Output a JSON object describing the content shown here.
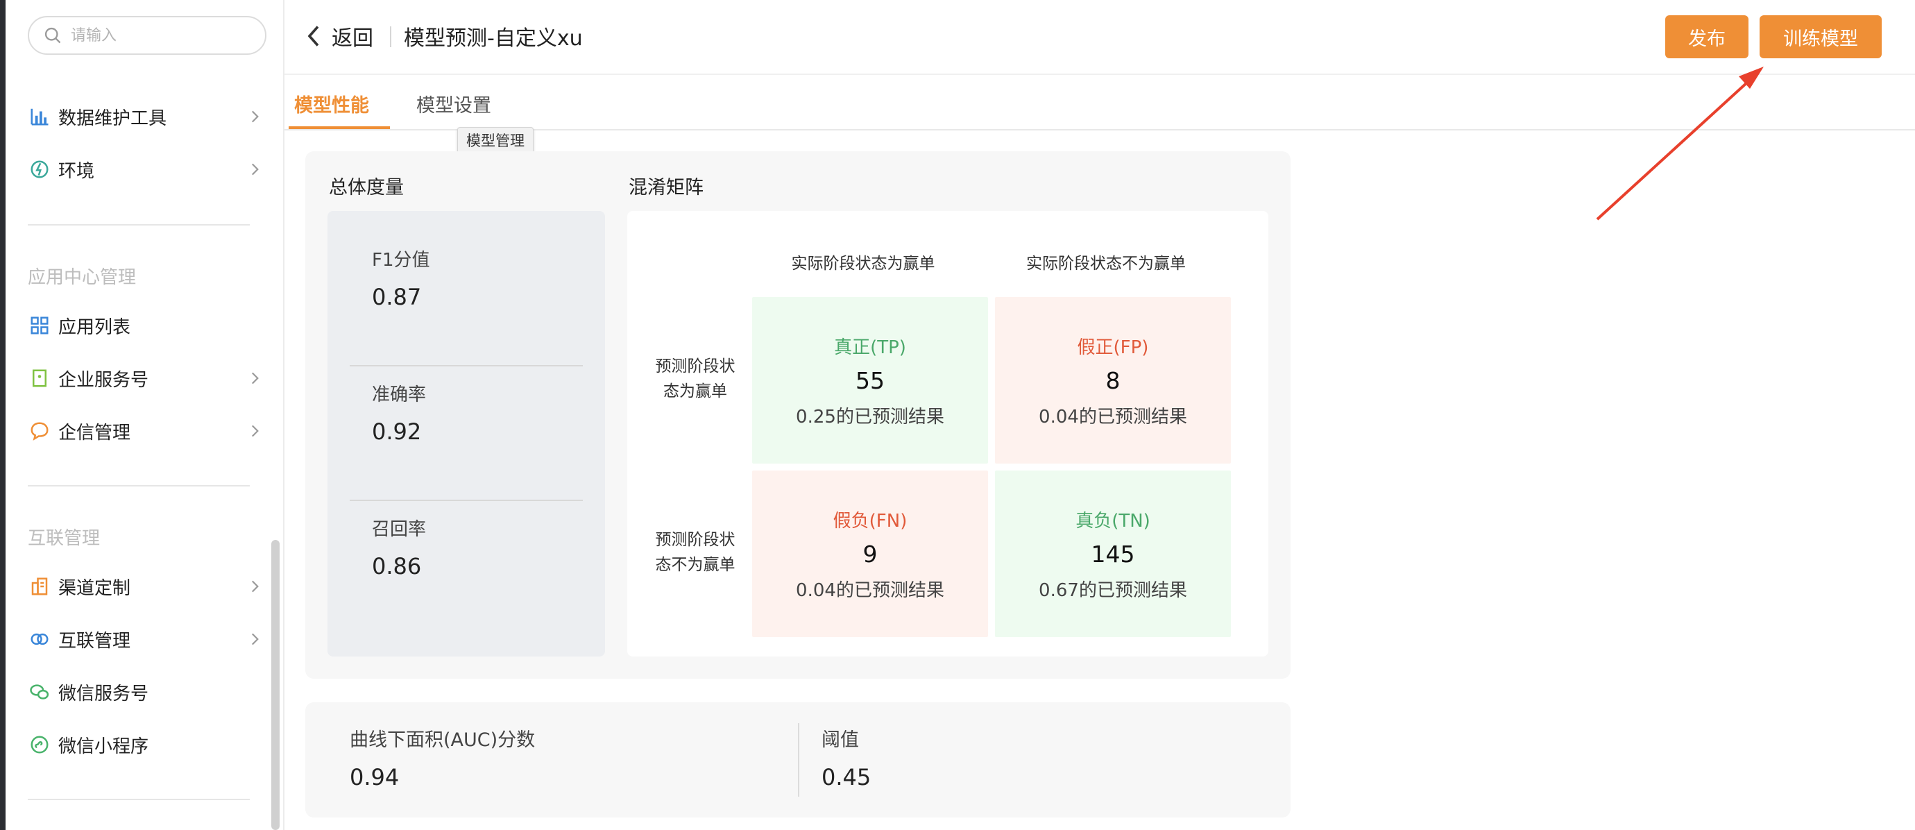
{
  "sidebar": {
    "search_placeholder": "请输入",
    "items": [
      {
        "label": "数据维护工具"
      },
      {
        "label": "环境"
      },
      {
        "label": "应用列表"
      },
      {
        "label": "企业服务号"
      },
      {
        "label": "企信管理"
      },
      {
        "label": "渠道定制"
      },
      {
        "label": "互联管理"
      },
      {
        "label": "微信服务号"
      },
      {
        "label": "微信小程序"
      }
    ],
    "sections": [
      {
        "title": "应用中心管理"
      },
      {
        "title": "互联管理"
      }
    ]
  },
  "header": {
    "back_label": "返回",
    "title": "模型预测-自定义xu",
    "publish_label": "发布",
    "train_label": "训练模型"
  },
  "tabs": {
    "performance": "模型性能",
    "settings": "模型设置",
    "tooltip": "模型管理"
  },
  "overall": {
    "title": "总体度量",
    "metrics": [
      {
        "label": "F1分值",
        "value": "0.87"
      },
      {
        "label": "准确率",
        "value": "0.92"
      },
      {
        "label": "召回率",
        "value": "0.86"
      }
    ]
  },
  "matrix": {
    "title": "混淆矩阵",
    "col_headers": [
      "实际阶段状态为赢单",
      "实际阶段状态不为赢单"
    ],
    "row_headers": [
      {
        "line1": "预测阶段状",
        "line2": "态为赢单"
      },
      {
        "line1": "预测阶段状",
        "line2": "态不为赢单"
      }
    ],
    "cells": [
      {
        "name": "真正(TP)",
        "value": "55",
        "desc": "0.25的已预测结果"
      },
      {
        "name": "假正(FP)",
        "value": "8",
        "desc": "0.04的已预测结果"
      },
      {
        "name": "假负(FN)",
        "value": "9",
        "desc": "0.04的已预测结果"
      },
      {
        "name": "真负(TN)",
        "value": "145",
        "desc": "0.67的已预测结果"
      }
    ]
  },
  "auc": {
    "label": "曲线下面积(AUC)分数",
    "value": "0.94",
    "threshold_label": "阈值",
    "threshold_value": "0.45"
  },
  "colors": {
    "accent": "#ef8f36",
    "positive_bg": "#eefbf0",
    "negative_bg": "#fef2ee",
    "annotation_arrow": "#e8402c"
  }
}
